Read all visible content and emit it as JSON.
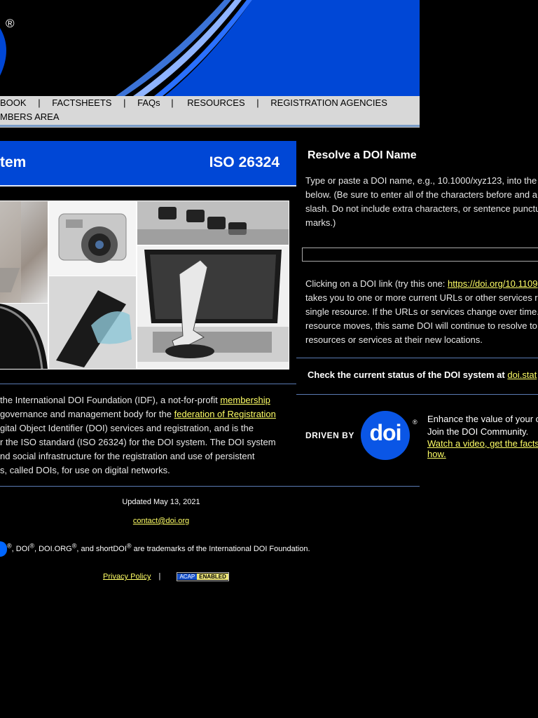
{
  "header": {
    "registered_mark": "®"
  },
  "nav": {
    "items": [
      "BOOK",
      "FACTSHEETS",
      "FAQs",
      "RESOURCES",
      "REGISTRATION AGENCIES"
    ],
    "separator": "|",
    "row2_item": "MBERS AREA"
  },
  "title_bar": {
    "left": "tem",
    "right": "ISO 26324"
  },
  "intro": {
    "line1_prefix": "the International DOI Foundation (IDF), a not-for-profit ",
    "line1_link": "membership",
    "line2_prefix": "governance and management body for the ",
    "line2_link": "federation of Registration",
    "line3": "gital Object Identifier (DOI) services and registration, and is the",
    "line4": "r the ISO standard (ISO 26324) for the DOI system. The DOI system",
    "line5": "nd social infrastructure for the registration and use of persistent",
    "line6": "s, called DOIs, for use on digital networks."
  },
  "footer": {
    "updated": "Updated May 13, 2021",
    "contact": "contact@doi.org",
    "tm_reg": "®",
    "tm_doi": ", DOI",
    "tm_doiorg": ", DOI.ORG",
    "tm_short": ", and shortDOI",
    "tm_suffix": " are trademarks of the International DOI Foundation.",
    "privacy": "Privacy Policy",
    "privacy_sep": "|",
    "acap_left": "ACAP",
    "acap_right": "ENABLED"
  },
  "resolve": {
    "title": "Resolve a DOI Name",
    "help_lines": [
      "Type or paste a DOI name, e.g., 10.1000/xyz123, into the",
      "below. (Be sure to enter all of the characters before and a",
      "slash. Do not include extra characters, or sentence punctu",
      "marks.)"
    ],
    "input_value": "",
    "click_prefix": "Clicking on a DOI link (try this one: ",
    "click_link": "https://doi.org/10.1109",
    "click_lines": [
      "takes you to one or more current URLs or other services r",
      "single resource. If the URLs or services change over time.",
      "resource moves, this same DOI will continue to resolve to",
      "resources or services at their new locations."
    ]
  },
  "status": {
    "text": "Check the current status of the DOI system at ",
    "link": "doi.stat"
  },
  "driven": {
    "label": "DRIVEN BY",
    "logo_text": "doi",
    "reg": "®",
    "line1": "Enhance the value of your c",
    "line2": "Join the DOI Community.",
    "link1": "Watch a video, get the facts",
    "link2": "how."
  },
  "colors": {
    "banner_blue": "#0047d6",
    "link_yellow": "#ffff66",
    "nav_grey": "#d8d8d8"
  }
}
